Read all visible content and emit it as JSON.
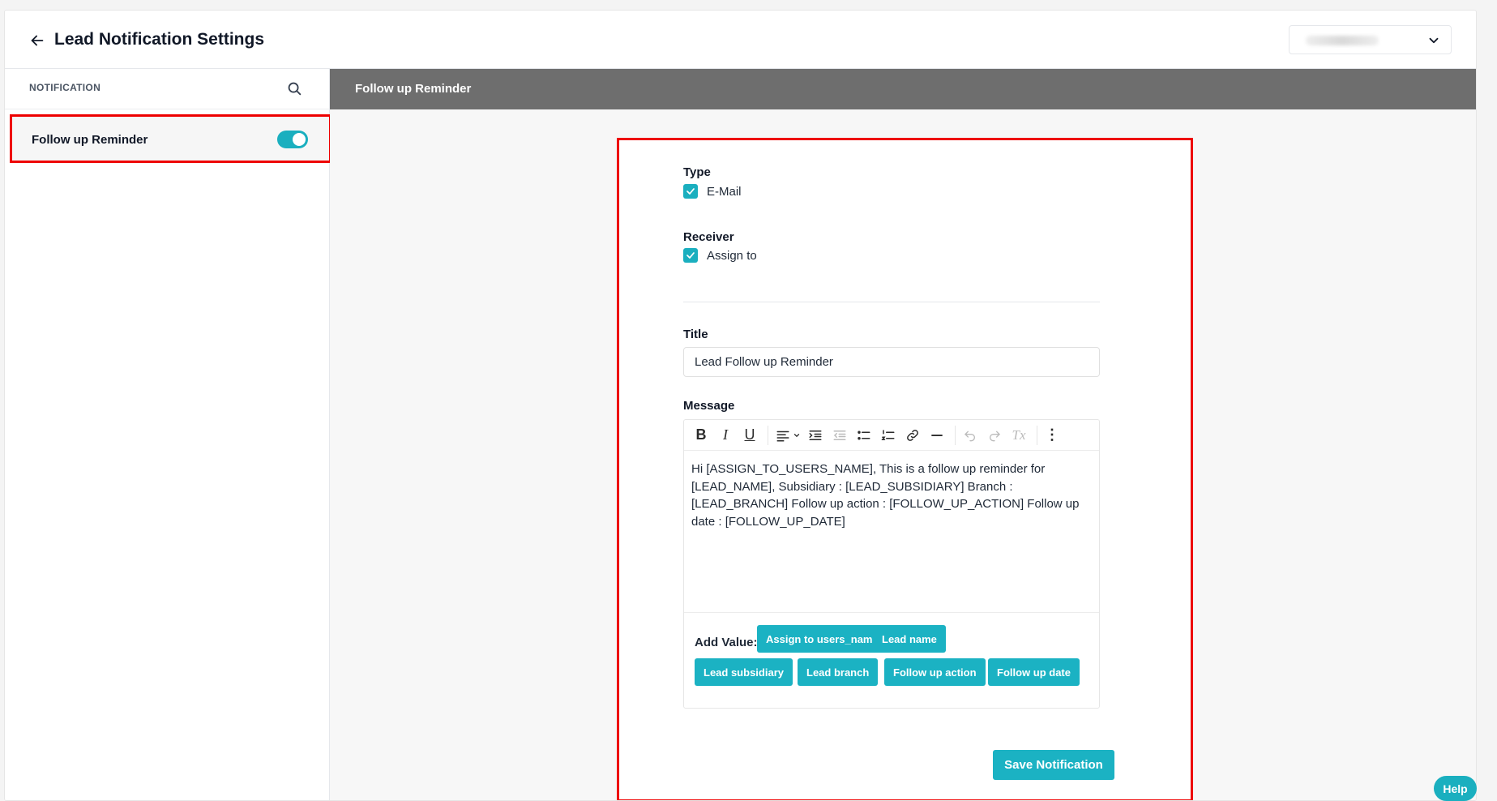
{
  "header": {
    "title": "Lead Notification Settings",
    "back_icon": "arrow-left-icon",
    "select_icon": "chevron-down-icon"
  },
  "sidebar": {
    "heading": "NOTIFICATION",
    "search_icon": "search-icon",
    "items": [
      {
        "label": "Follow up Reminder",
        "enabled": true
      }
    ]
  },
  "main": {
    "section_title": "Follow up Reminder",
    "type": {
      "label": "Type",
      "options": [
        {
          "label": "E-Mail",
          "checked": true
        }
      ]
    },
    "receiver": {
      "label": "Receiver",
      "options": [
        {
          "label": "Assign to",
          "checked": true
        }
      ]
    },
    "title": {
      "label": "Title",
      "value": "Lead Follow up Reminder"
    },
    "message": {
      "label": "Message",
      "toolbar": [
        "B",
        "I",
        "U",
        "≡",
        "⌄",
        "⇥",
        "⇤",
        "☰",
        "⒈",
        "🔗",
        "—",
        "↶",
        "↷",
        "Tx",
        "⋮"
      ],
      "body": "Hi [ASSIGN_TO_USERS_NAME], This is a follow up reminder for [LEAD_NAME], Subsidiary : [LEAD_SUBSIDIARY] Branch : [LEAD_BRANCH] Follow up action : [FOLLOW_UP_ACTION] Follow up date : [FOLLOW_UP_DATE]"
    },
    "add_value": {
      "label": "Add Value:",
      "buttons": [
        "Assign to users_name",
        "Lead name",
        "Lead subsidiary",
        "Lead branch",
        "Follow up action",
        "Follow up date"
      ]
    },
    "save_label": "Save Notification"
  },
  "help_label": "Help",
  "colors": {
    "accent": "#1aafbf",
    "highlight": "#ee0000",
    "section_bar": "#6e6e6e"
  }
}
